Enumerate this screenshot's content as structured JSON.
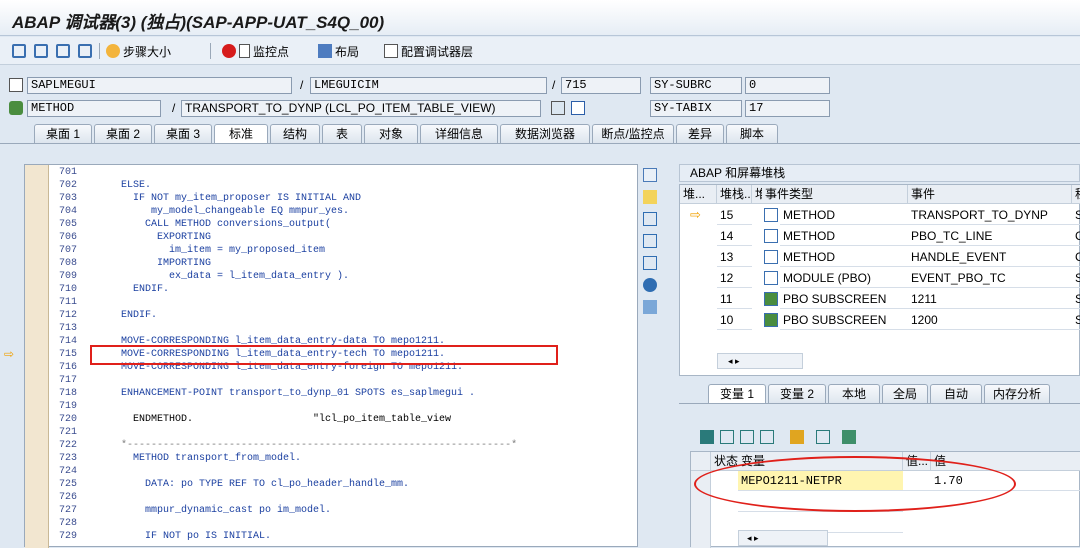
{
  "window": {
    "title": "ABAP 调试器(3)  (独占)(SAP-APP-UAT_S4Q_00)"
  },
  "toolbar": {
    "step_size": "步骤大小",
    "breakpoint": "监控点",
    "layout": "布局",
    "config": "配置调试器层"
  },
  "fields": {
    "program": "SAPLMEGUI",
    "include": "LMEGUICIM",
    "line": "715",
    "subrc_label": "SY-SUBRC",
    "subrc_value": "0",
    "event_type": "METHOD",
    "event": "TRANSPORT_TO_DYNP (LCL_PO_ITEM_TABLE_VIEW)",
    "tabix_label": "SY-TABIX",
    "tabix_value": "17"
  },
  "tabs": [
    "桌面 1",
    "桌面 2",
    "桌面 3",
    "标准",
    "结构",
    "表",
    "对象",
    "详细信息",
    "数据浏览器",
    "断点/监控点",
    "差异",
    "脚本"
  ],
  "code_lines": [
    {
      "n": "701",
      "t": ""
    },
    {
      "n": "702",
      "t": "ELSE."
    },
    {
      "n": "703",
      "t": "  IF NOT my_item_proposer IS INITIAL AND"
    },
    {
      "n": "704",
      "t": "     my_model_changeable EQ mmpur_yes."
    },
    {
      "n": "705",
      "t": "    CALL METHOD conversions_output("
    },
    {
      "n": "706",
      "t": "      EXPORTING"
    },
    {
      "n": "707",
      "t": "        im_item = my_proposed_item"
    },
    {
      "n": "708",
      "t": "      IMPORTING"
    },
    {
      "n": "709",
      "t": "        ex_data = l_item_data_entry )."
    },
    {
      "n": "710",
      "t": "  ENDIF."
    },
    {
      "n": "711",
      "t": ""
    },
    {
      "n": "712",
      "t": "ENDIF."
    },
    {
      "n": "713",
      "t": ""
    },
    {
      "n": "714",
      "t": "MOVE-CORRESPONDING l_item_data_entry-data TO mepo1211."
    },
    {
      "n": "715",
      "t": "MOVE-CORRESPONDING l_item_data_entry-tech TO mepo1211."
    },
    {
      "n": "716",
      "t": "MOVE-CORRESPONDING l_item_data_entry-foreign TO mepo1211."
    },
    {
      "n": "717",
      "t": ""
    },
    {
      "n": "718",
      "t": "ENHANCEMENT-POINT transport_to_dynp_01 SPOTS es_saplmegui ."
    },
    {
      "n": "719",
      "t": ""
    },
    {
      "n": "720",
      "t": "  ENDMETHOD.                    \"lcl_po_item_table_view"
    },
    {
      "n": "721",
      "t": ""
    },
    {
      "n": "722",
      "t": "*----------------------------------------------------------------*"
    },
    {
      "n": "723",
      "t": "  METHOD transport_from_model."
    },
    {
      "n": "724",
      "t": ""
    },
    {
      "n": "725",
      "t": "    DATA: po TYPE REF TO cl_po_header_handle_mm."
    },
    {
      "n": "726",
      "t": ""
    },
    {
      "n": "727",
      "t": "    mmpur_dynamic_cast po im_model."
    },
    {
      "n": "728",
      "t": ""
    },
    {
      "n": "729",
      "t": "    IF NOT po IS INITIAL."
    }
  ],
  "stack": {
    "title": "ABAP 和屏幕堆栈",
    "headers": [
      "堆...",
      "堆栈...",
      "堆.",
      "事件类型",
      "事件",
      "程"
    ],
    "rows": [
      {
        "depth": "15",
        "type": "METHOD",
        "event": "TRANSPORT_TO_DYNP",
        "prog": "S."
      },
      {
        "depth": "14",
        "type": "METHOD",
        "event": "PBO_TC_LINE",
        "prog": "C"
      },
      {
        "depth": "13",
        "type": "METHOD",
        "event": "HANDLE_EVENT",
        "prog": "C"
      },
      {
        "depth": "12",
        "type": "MODULE (PBO)",
        "event": "EVENT_PBO_TC",
        "prog": "S."
      },
      {
        "depth": "11",
        "type": "PBO SUBSCREEN",
        "event": "1211",
        "prog": "S."
      },
      {
        "depth": "10",
        "type": "PBO SUBSCREEN",
        "event": "1200",
        "prog": "S."
      }
    ]
  },
  "var_tabs": [
    "变量 1",
    "变量 2",
    "本地",
    "全局",
    "自动",
    "内存分析"
  ],
  "vars": {
    "headers": [
      "状态",
      "变量",
      "值...",
      "值"
    ],
    "rows": [
      {
        "name": "MEPO1211-NETPR",
        "value": "1.70"
      }
    ]
  },
  "colors": {
    "accent_red": "#e0201a",
    "arrow": "#f0a000"
  }
}
